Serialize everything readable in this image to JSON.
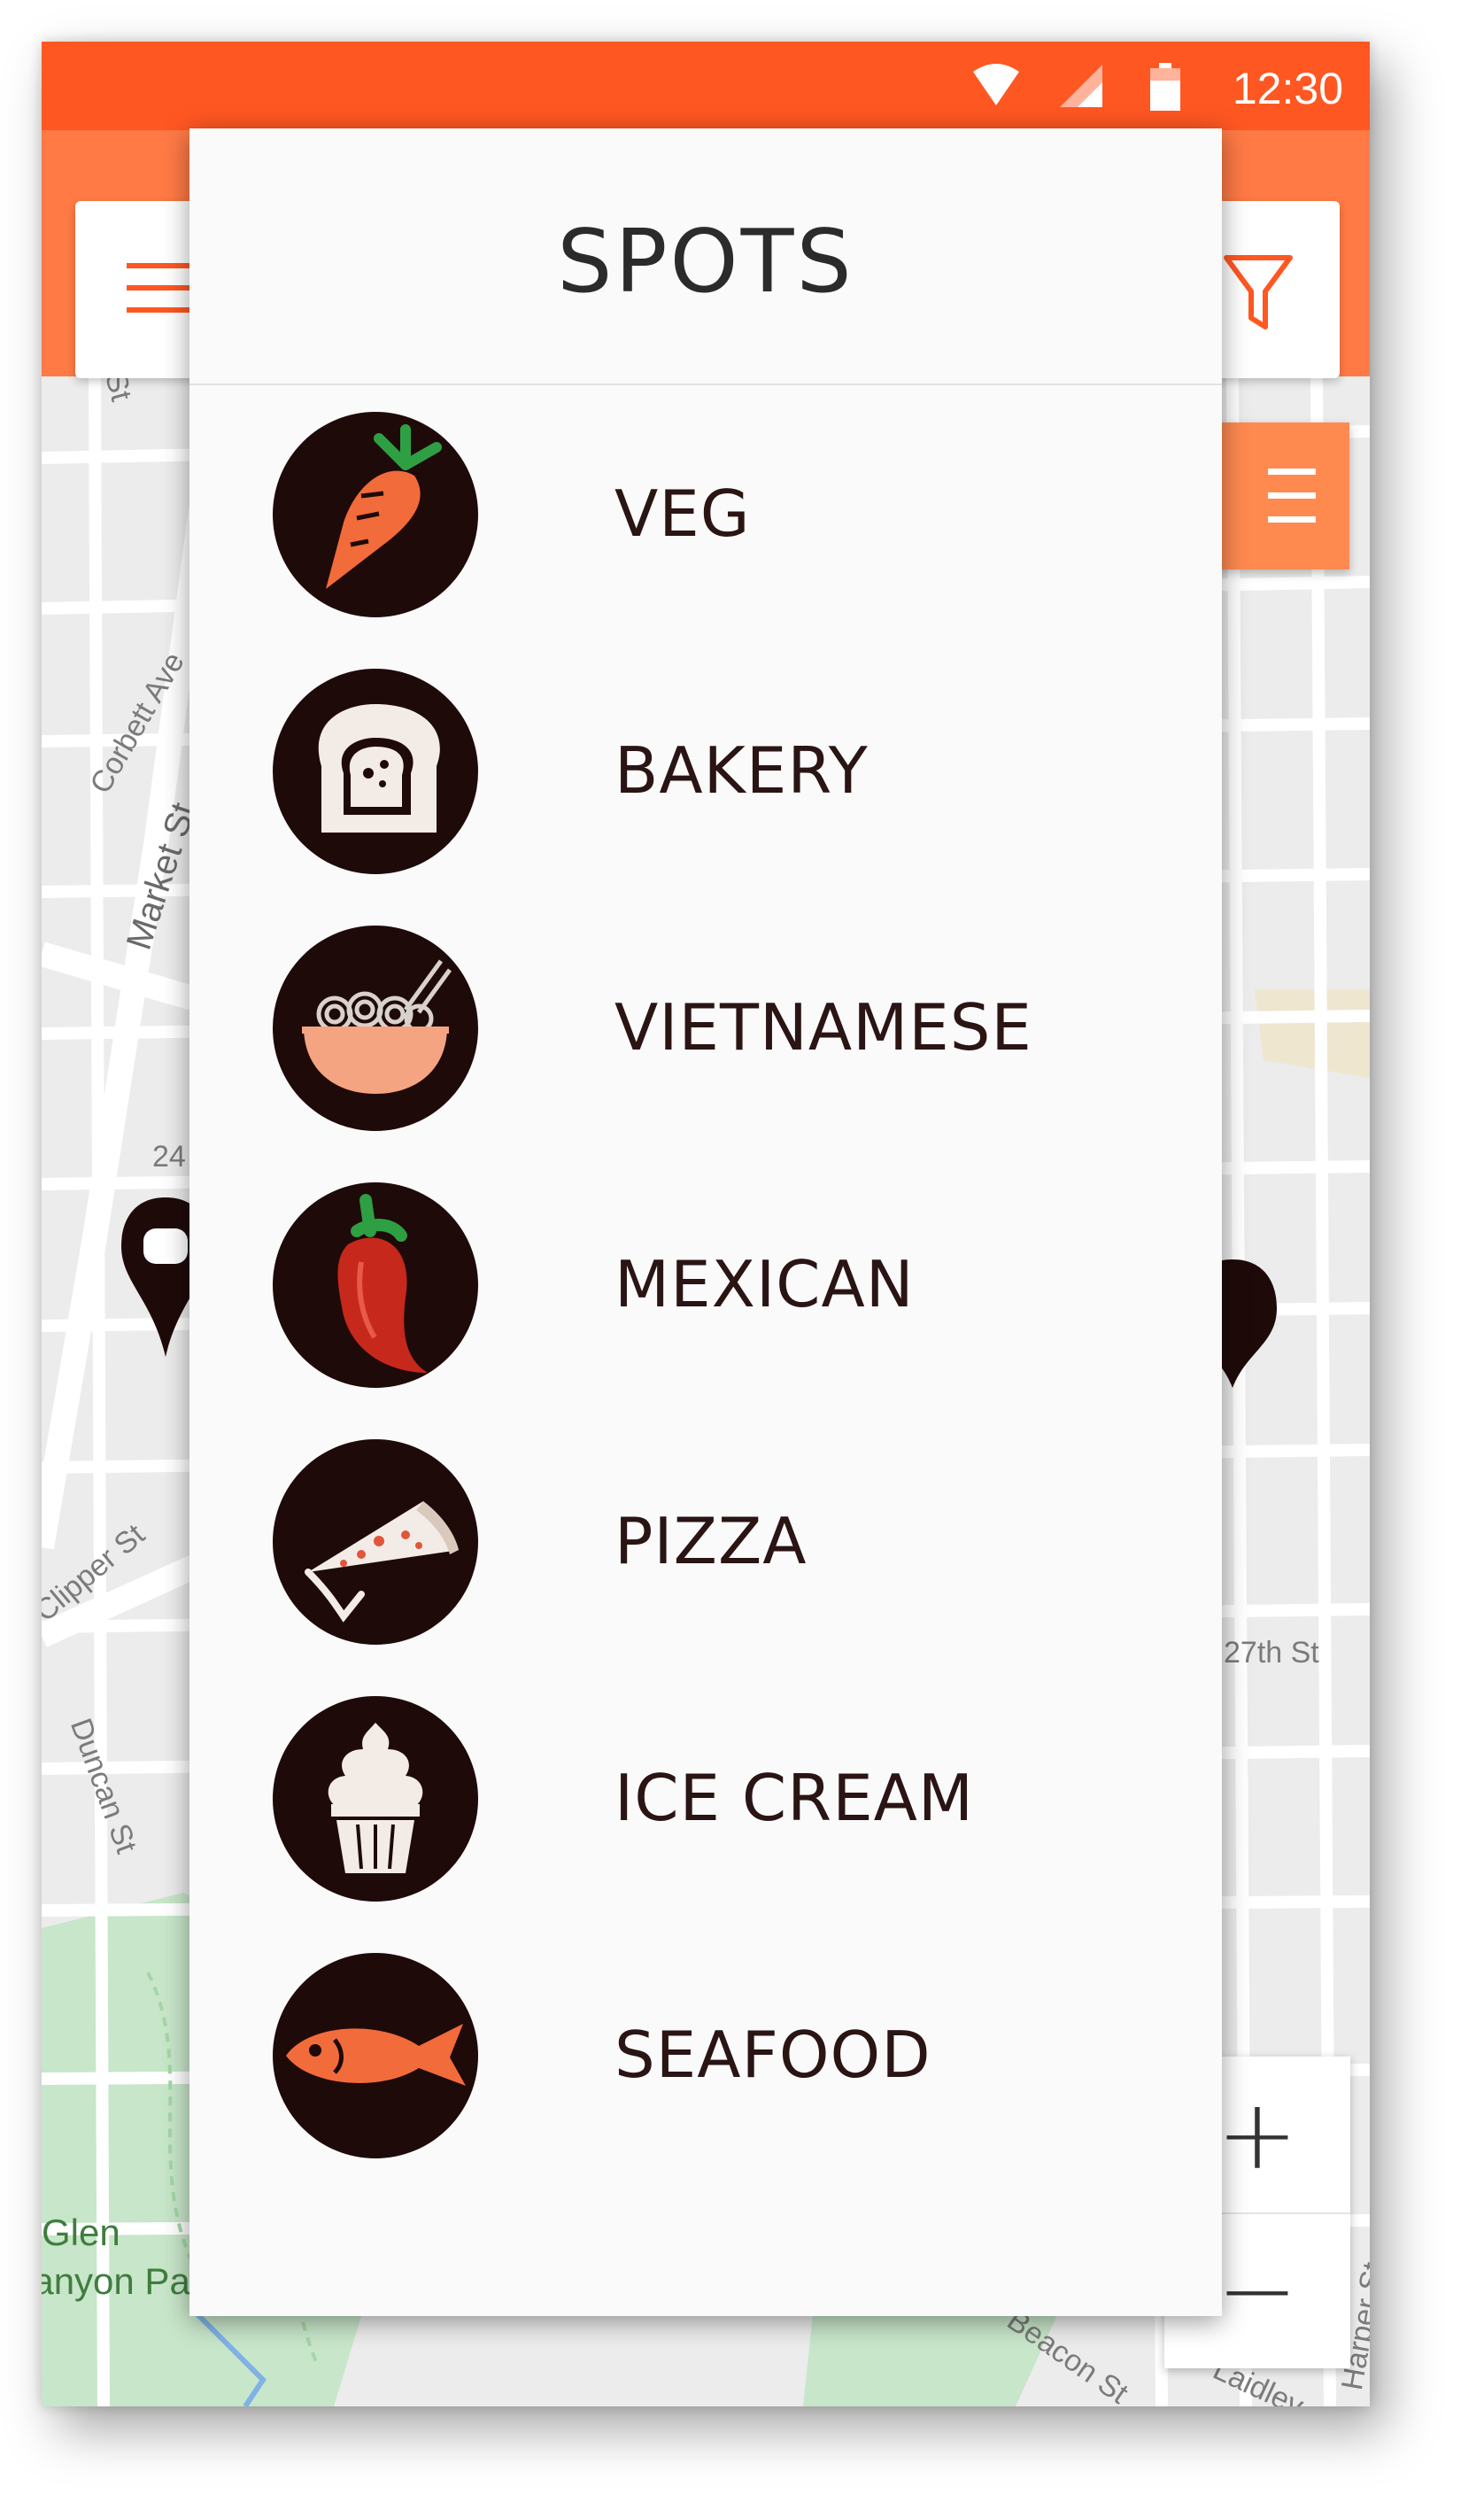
{
  "status_bar": {
    "time": "12:30"
  },
  "colors": {
    "primary": "#ff5722",
    "accent": "#ff7a45",
    "icon_bg": "#1f0a0a",
    "drawer_bg": "#fafafa"
  },
  "map_labels": [
    "St",
    "Corbett Ave",
    "Market St",
    "24",
    "Clipper St",
    "Duncan St",
    "Glen",
    "Canyon Park",
    "27th St",
    "Beacon St",
    "Laidley",
    "Harper St"
  ],
  "drawer": {
    "title": "SPOTS",
    "items": [
      {
        "label": "VEG",
        "icon": "carrot-icon"
      },
      {
        "label": "BAKERY",
        "icon": "bread-icon"
      },
      {
        "label": "VIETNAMESE",
        "icon": "noodle-bowl-icon"
      },
      {
        "label": "MEXICAN",
        "icon": "chili-pepper-icon"
      },
      {
        "label": "PIZZA",
        "icon": "pizza-slice-icon"
      },
      {
        "label": "ICE CREAM",
        "icon": "ice-cream-icon"
      },
      {
        "label": "SEAFOOD",
        "icon": "fish-icon"
      }
    ]
  },
  "controls": {
    "zoom_in": "+",
    "zoom_out": "−"
  }
}
